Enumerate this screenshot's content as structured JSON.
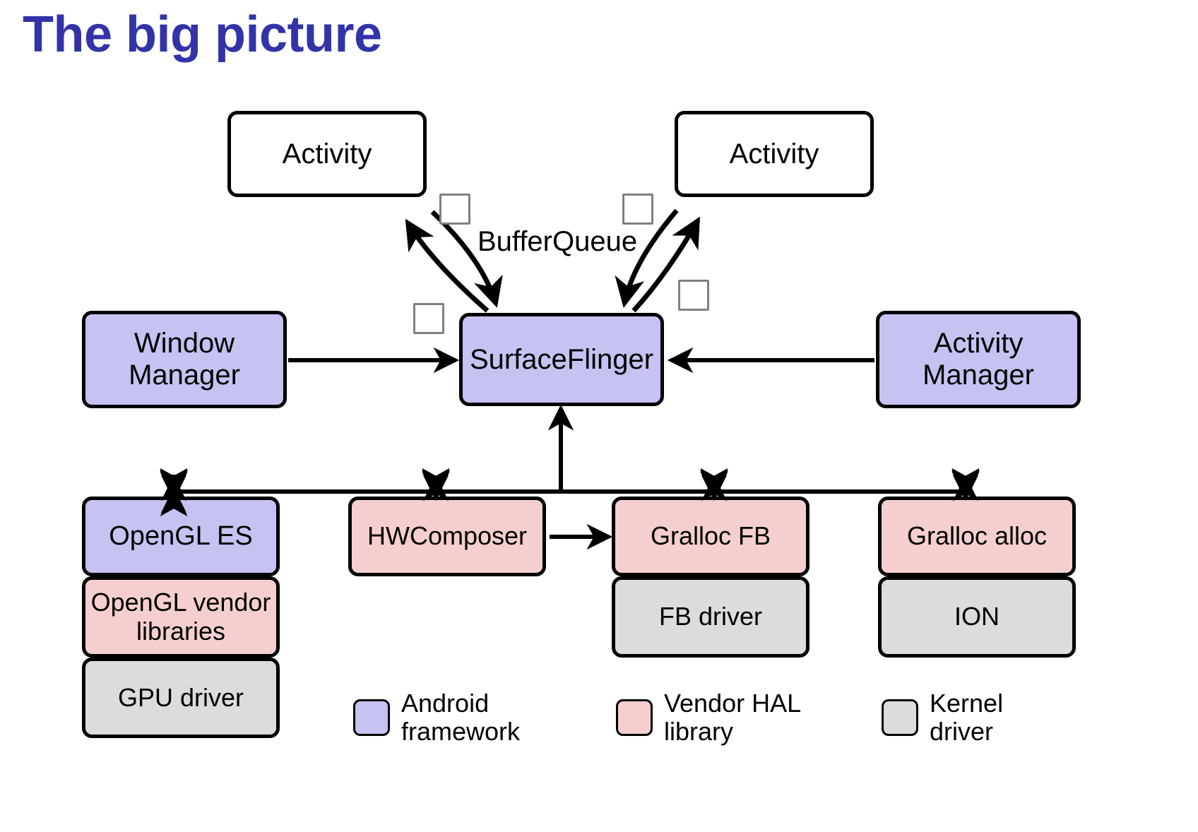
{
  "slide": {
    "title": "The big picture",
    "title_color": "#3333a8",
    "background": "#ffffff"
  },
  "palette": {
    "android_framework": "#c5c3f2",
    "vendor_hal_library": "#f5cfcf",
    "kernel_driver": "#dcdcdc",
    "plain_box": "#ffffff",
    "outline": "#000000",
    "buffer_square_outline": "#808080"
  },
  "diagram": {
    "type": "block-diagram",
    "apps": [
      {
        "label": "Activity",
        "kind": "plain"
      },
      {
        "label": "Activity",
        "kind": "plain"
      }
    ],
    "bufferqueue_label": "BufferQueue",
    "buffer_squares_count": 4,
    "compositor": {
      "label": "SurfaceFlinger",
      "kind": "android_framework"
    },
    "managers": [
      {
        "label": "Window\nManager",
        "kind": "android_framework"
      },
      {
        "label": "Activity\nManager",
        "kind": "android_framework"
      }
    ],
    "stacks": [
      {
        "name": "opengl-stack",
        "layers": [
          {
            "label": "OpenGL ES",
            "kind": "android_framework"
          },
          {
            "label": "OpenGL vendor\nlibraries",
            "kind": "vendor_hal_library"
          },
          {
            "label": "GPU driver",
            "kind": "kernel_driver"
          }
        ]
      },
      {
        "name": "hwcomposer-stack",
        "layers": [
          {
            "label": "HWComposer",
            "kind": "vendor_hal_library"
          }
        ]
      },
      {
        "name": "gralloc-fb-stack",
        "layers": [
          {
            "label": "Gralloc FB",
            "kind": "vendor_hal_library"
          },
          {
            "label": "FB driver",
            "kind": "kernel_driver"
          }
        ]
      },
      {
        "name": "gralloc-alloc-stack",
        "layers": [
          {
            "label": "Gralloc alloc",
            "kind": "vendor_hal_library"
          },
          {
            "label": "ION",
            "kind": "kernel_driver"
          }
        ]
      }
    ],
    "edges": [
      {
        "from": "Window Manager",
        "to": "SurfaceFlinger",
        "style": "straight-arrow"
      },
      {
        "from": "Activity Manager",
        "to": "SurfaceFlinger",
        "style": "straight-arrow"
      },
      {
        "from": "Activity (left)",
        "to": "SurfaceFlinger",
        "style": "curved-pair"
      },
      {
        "from": "Activity (right)",
        "to": "SurfaceFlinger",
        "style": "curved-pair"
      },
      {
        "from": "SurfaceFlinger",
        "to": "OpenGL ES",
        "style": "bus-branch"
      },
      {
        "from": "SurfaceFlinger",
        "to": "HWComposer",
        "style": "bus-branch"
      },
      {
        "from": "SurfaceFlinger",
        "to": "Gralloc FB",
        "style": "bus-branch"
      },
      {
        "from": "SurfaceFlinger",
        "to": "Gralloc alloc",
        "style": "bus-branch"
      },
      {
        "from": "HWComposer",
        "to": "Gralloc FB",
        "style": "straight-arrow"
      }
    ]
  },
  "legend": {
    "items": [
      {
        "label": "Android\nframework",
        "color": "#c5c3f2"
      },
      {
        "label": "Vendor HAL\nlibrary",
        "color": "#f5cfcf"
      },
      {
        "label": "Kernel\ndriver",
        "color": "#dcdcdc"
      }
    ]
  }
}
